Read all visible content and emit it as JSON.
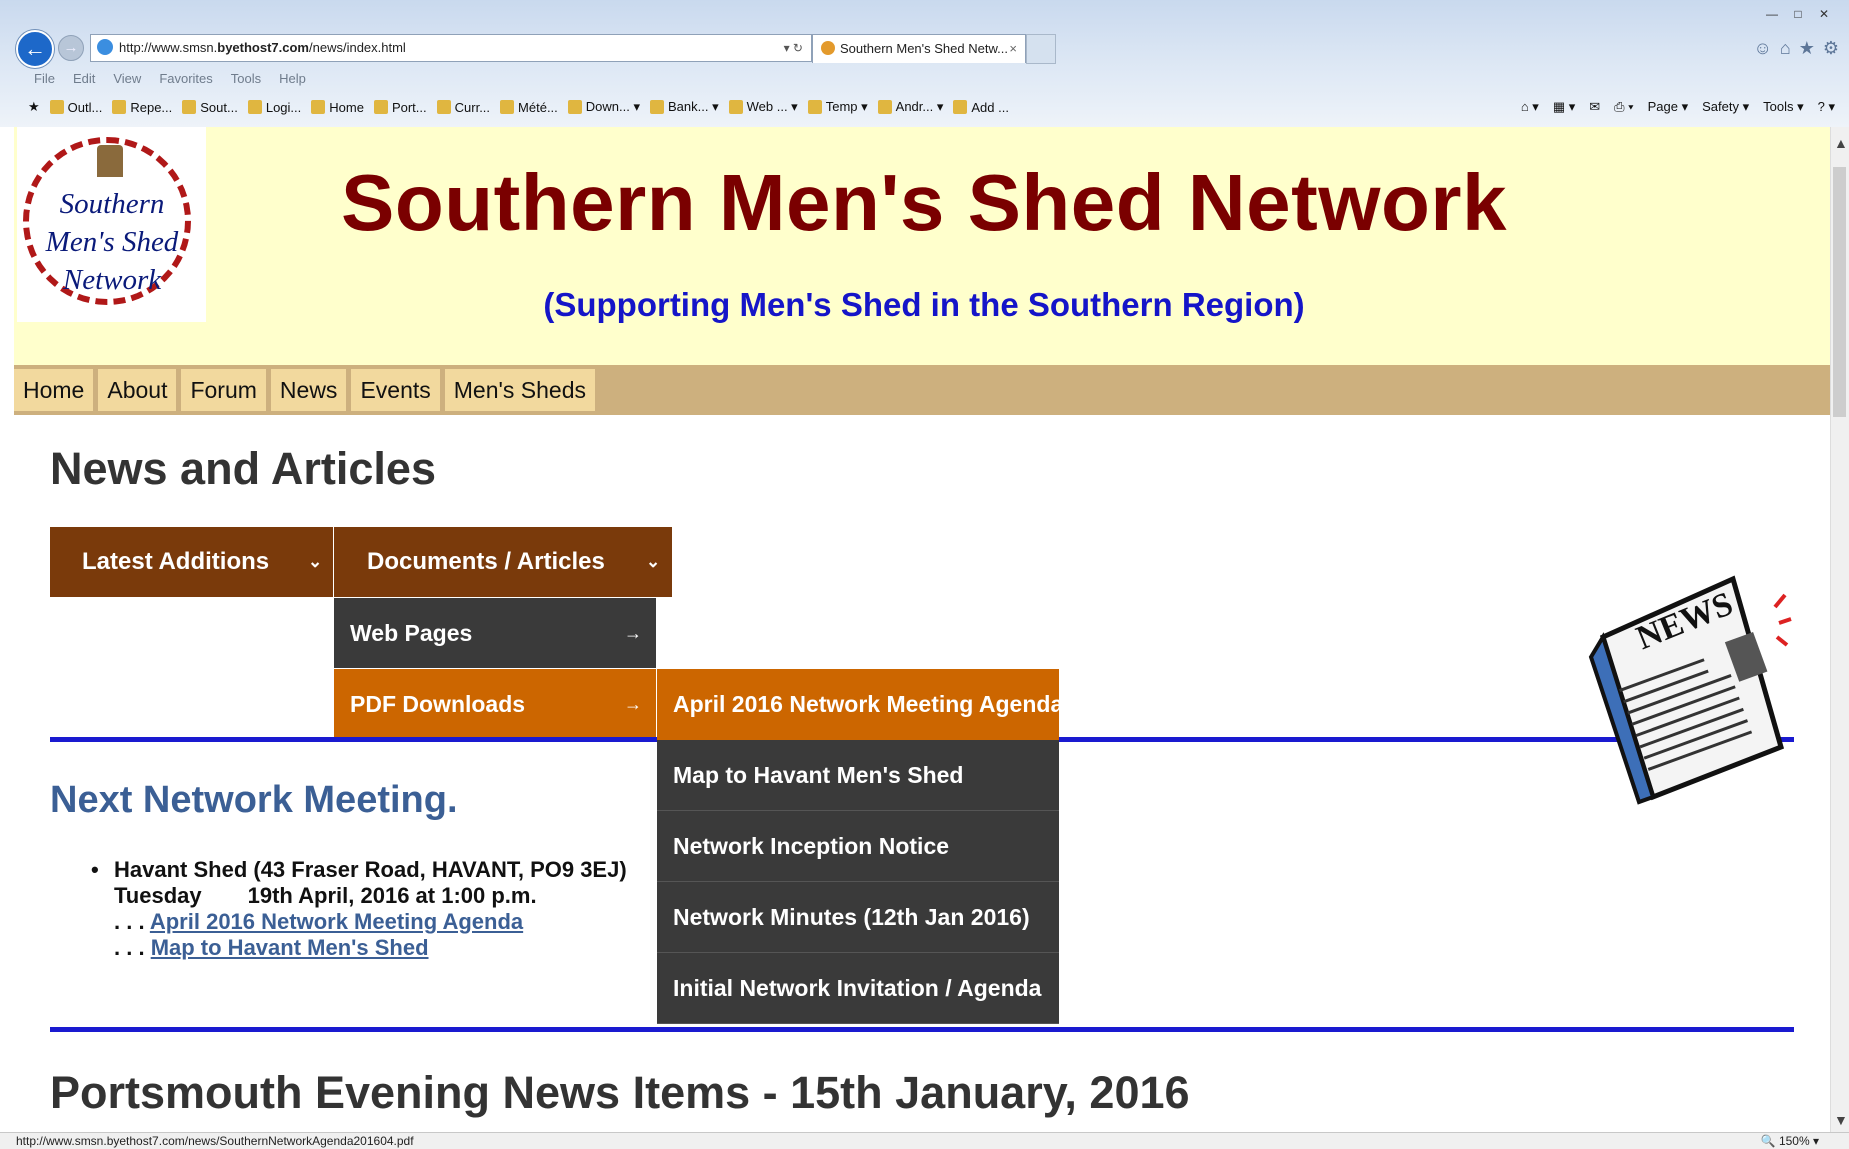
{
  "browser": {
    "url_prefix": "http://www.smsn.",
    "url_domain": "byethost7.com",
    "url_path": "/news/index.html",
    "url_controls": "▾ ↻",
    "tab_title": "Southern Men's Shed Netw...",
    "tab_close": "×",
    "window_controls": [
      "—",
      "□",
      "✕"
    ],
    "right_icons": [
      "☺",
      "⌂",
      "★",
      "⚙"
    ],
    "menu": [
      "File",
      "Edit",
      "View",
      "Favorites",
      "Tools",
      "Help"
    ],
    "favorites": [
      "Outl...",
      "Repe...",
      "Sout...",
      "Logi...",
      "Home",
      "Port...",
      "Curr...",
      "Mété...",
      "Down... ▾",
      "Bank... ▾",
      "Web ... ▾",
      "Temp ▾",
      "Andr... ▾",
      "Add ..."
    ],
    "command_bar": [
      "⌂ ▾",
      "▦ ▾",
      "✉",
      "⎙ ▾",
      "Page ▾",
      "Safety ▾",
      "Tools ▾",
      "? ▾"
    ],
    "status_url": "http://www.smsn.byethost7.com/news/SouthernNetworkAgenda201604.pdf",
    "zoom": "150%"
  },
  "header": {
    "logo_text": [
      "Southern",
      "Men's Shed",
      "Network"
    ],
    "title": "Southern Men's Shed Network",
    "subtitle": "(Supporting Men's Shed in the Southern Region)"
  },
  "nav": [
    "Home",
    "About",
    "Forum",
    "News",
    "Events",
    "Men's Sheds"
  ],
  "main": {
    "heading": "News and Articles",
    "menu": {
      "latest": "Latest Additions",
      "documents": "Documents / Articles",
      "chevron": "⌄",
      "sub": [
        "Web Pages",
        "PDF Downloads"
      ],
      "arrow": "→",
      "pdf_items": [
        "April 2016 Network Meeting Agenda",
        "Map to Havant Men's Shed",
        "Network Inception Notice",
        "Network Minutes (12th Jan 2016)",
        "Initial Network Invitation / Agenda"
      ]
    },
    "next_meeting": {
      "heading": "Next Network Meeting.",
      "bullet": "•",
      "venue": "Havant Shed (43 Fraser Road, HAVANT, PO9 3EJ)",
      "day": "Tuesday",
      "date": "19th April, 2016 at 1:00 p.m.",
      "prefix": ". . .",
      "links": [
        "April 2016 Network Meeting Agenda",
        "Map to Havant Men's Shed"
      ]
    },
    "news_image_text": "NEWS",
    "portsmouth_heading": "Portsmouth Evening News Items - 15th January, 2016"
  }
}
